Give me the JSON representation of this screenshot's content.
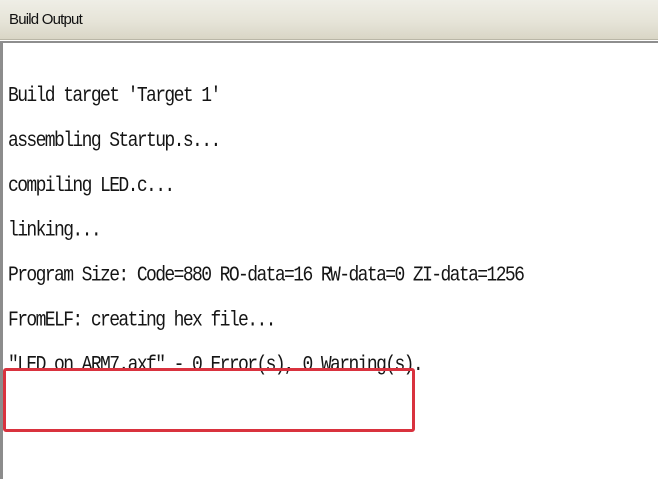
{
  "window": {
    "title": "Build Output"
  },
  "output": {
    "lines": [
      "Build target 'Target 1'",
      "assembling Startup.s...",
      "compiling LED.c...",
      "linking...",
      "Program Size: Code=880 RO-data=16 RW-data=0 ZI-data=1256",
      "FromELF: creating hex file...",
      "\"LED on ARM7.axf\" - 0 Error(s), 0 Warning(s)."
    ]
  },
  "colors": {
    "highlight_border": "#d9323e",
    "titlebar": "#e6e4d8",
    "text": "#151515"
  }
}
